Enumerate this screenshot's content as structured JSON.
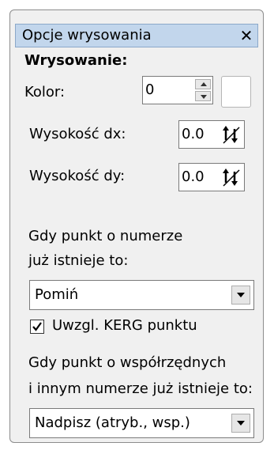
{
  "window": {
    "title": "Opcje wrysowania",
    "close_glyph": "✕"
  },
  "section": {
    "heading": "Wrysowanie:"
  },
  "color": {
    "label": "Kolor:",
    "value": "0",
    "swatch_color": "#ffffff"
  },
  "height_dx": {
    "label": "Wysokość dx:",
    "value": "0.0"
  },
  "height_dy": {
    "label": "Wysokość dy:",
    "value": "0.0"
  },
  "point_number_exists": {
    "line1": "Gdy punkt o numerze",
    "line2": "już istnieje to:",
    "selected": "Pomiń"
  },
  "kerg": {
    "label": "Uwzgl. KERG punktu",
    "checked": true
  },
  "point_coords_exists": {
    "line1": "Gdy punkt o współrzędnych",
    "line2": "i innym numerze już istnieje to:",
    "selected": "Nadpisz (atryb., wsp.)"
  },
  "icons": {
    "close": "close-icon",
    "spin_up": "spin-up-icon",
    "spin_down": "spin-down-icon",
    "dxdy": "arrows-up-down-icon",
    "dropdown": "chevron-down-icon",
    "check": "checkmark-icon"
  }
}
